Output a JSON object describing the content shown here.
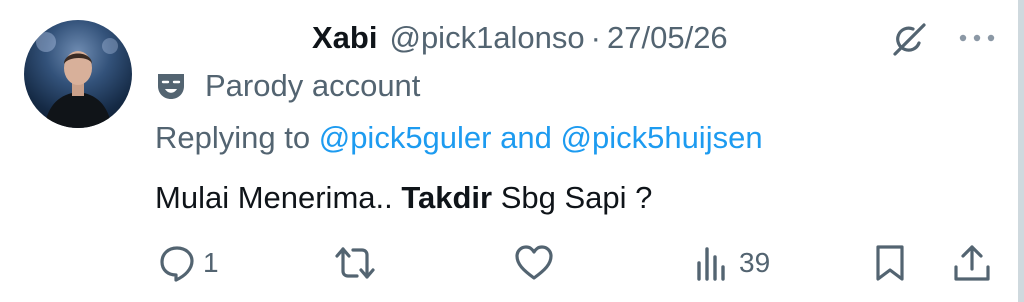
{
  "tweet": {
    "author_name": "Xabi",
    "handle": "@pick1alonso",
    "separator": "·",
    "date": "27/05/26",
    "label": "Parody account",
    "reply_prefix": "Replying to",
    "reply_user1": "@pick5guler",
    "reply_and": "and",
    "reply_user2": "@pick5huijsen",
    "text_before": "Mulai Menerima..",
    "text_bold": "Takdir",
    "text_after": "Sbg Sapi ?"
  },
  "actions": {
    "reply_count": "1",
    "retweet_count": "",
    "like_count": "",
    "views_count": "39"
  },
  "icons": {
    "avatar": "avatar",
    "parody": "theater-mask-icon",
    "grok": "grok-icon",
    "more": "more-icon",
    "reply": "reply-icon",
    "retweet": "retweet-icon",
    "like": "heart-icon",
    "views": "views-icon",
    "bookmark": "bookmark-icon",
    "share": "share-icon"
  },
  "colors": {
    "text": "#0f1419",
    "muted": "#536471",
    "link": "#1d9bf0"
  }
}
